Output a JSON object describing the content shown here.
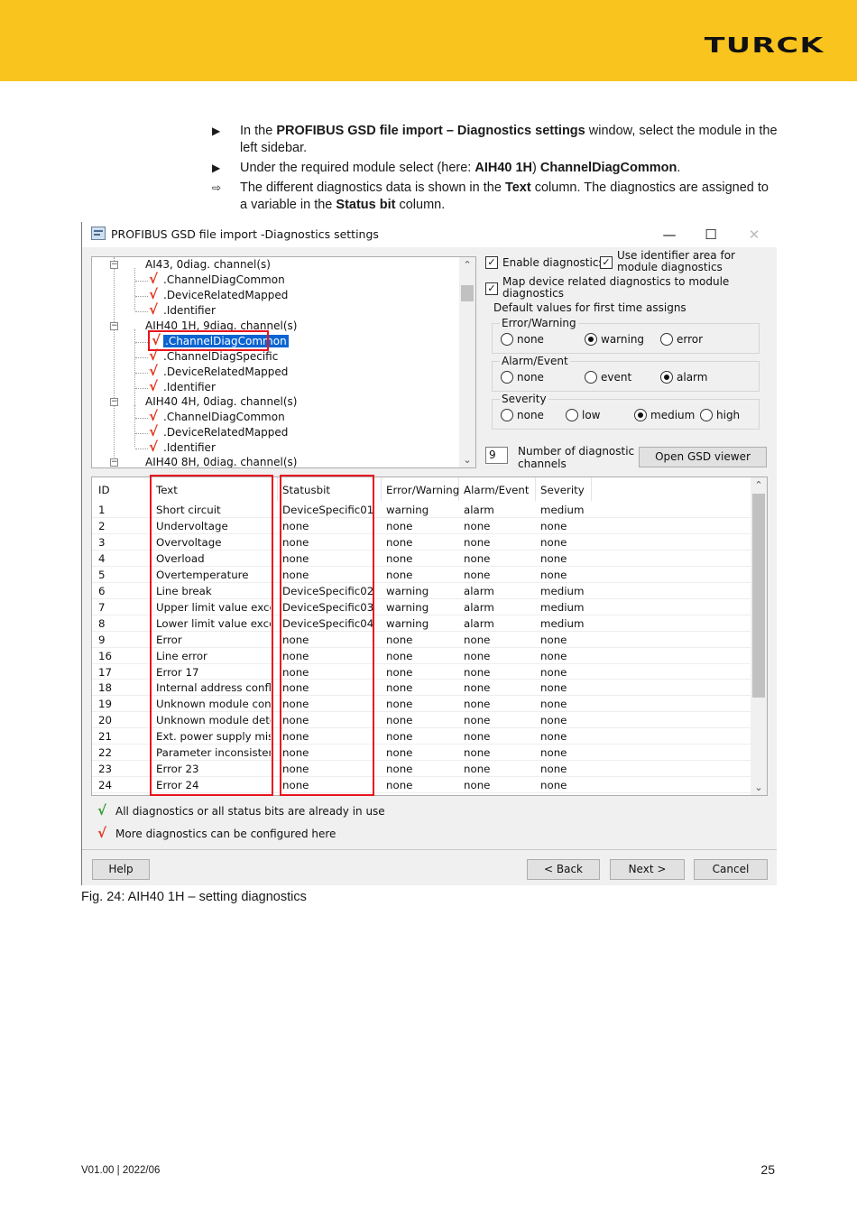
{
  "header": {
    "brand": "TURCK"
  },
  "instructions": [
    {
      "marker": "▶",
      "parts": [
        "In the ",
        "PROFIBUS GSD file import – Diagnostics settings",
        " window, select the module in the left sidebar."
      ]
    },
    {
      "marker": "▶",
      "parts": [
        "Under the required module select (here: ",
        "AIH40 1H",
        ") ",
        "ChannelDiagCommon",
        "."
      ]
    },
    {
      "marker": "⇨",
      "parts": [
        "The different diagnostics data is shown in the ",
        "Text",
        " column. The diagnostics are assigned to a variable in the ",
        "Status bit",
        " column."
      ]
    }
  ],
  "dialog": {
    "title": "PROFIBUS GSD file import -Diagnostics settings",
    "window_buttons": {
      "minimize": "—",
      "maximize": "☐",
      "close": "✕"
    },
    "tree": {
      "items": [
        {
          "kind": "module",
          "label": "AI43, 0diag. channel(s)"
        },
        {
          "kind": "leaf",
          "label": ".ChannelDiagCommon"
        },
        {
          "kind": "leaf",
          "label": ".DeviceRelatedMapped"
        },
        {
          "kind": "leaf",
          "label": ".Identifier"
        },
        {
          "kind": "module",
          "label": "AIH40 1H, 9diag. channel(s)"
        },
        {
          "kind": "leaf",
          "label": ".ChannelDiagCommon",
          "selected": true
        },
        {
          "kind": "leaf",
          "label": ".ChannelDiagSpecific"
        },
        {
          "kind": "leaf",
          "label": ".DeviceRelatedMapped"
        },
        {
          "kind": "leaf",
          "label": ".Identifier"
        },
        {
          "kind": "module",
          "label": "AIH40 4H, 0diag. channel(s)"
        },
        {
          "kind": "leaf",
          "label": ".ChannelDiagCommon"
        },
        {
          "kind": "leaf",
          "label": ".DeviceRelatedMapped"
        },
        {
          "kind": "leaf",
          "label": ".Identifier"
        },
        {
          "kind": "module",
          "label": "AIH40 8H, 0diag. channel(s)"
        }
      ]
    },
    "options": {
      "enable_diagnostics": {
        "label": "Enable diagnostics",
        "checked": true
      },
      "use_identifier": {
        "label_line1": "Use identifier area for",
        "label_line2": "module diagnostics",
        "checked": true
      },
      "map_device": {
        "label_line1": "Map device related diagnostics to module",
        "label_line2": "diagnostics",
        "checked": true
      },
      "defaults_title": "Default values for first time assigns",
      "error_warning": {
        "title": "Error/Warning",
        "options": [
          "none",
          "warning",
          "error"
        ],
        "selected": "warning"
      },
      "alarm_event": {
        "title": "Alarm/Event",
        "options": [
          "none",
          "event",
          "alarm"
        ],
        "selected": "alarm"
      },
      "severity": {
        "title": "Severity",
        "options": [
          "none",
          "low",
          "medium",
          "high"
        ],
        "selected": "medium"
      },
      "channels_value": "9",
      "channels_label_line1": "Number of diagnostic",
      "channels_label_line2": "channels",
      "open_gsd_viewer": "Open GSD viewer"
    },
    "table": {
      "headers": [
        "ID",
        "Text",
        "Statusbit",
        "Error/Warning",
        "Alarm/Event",
        "Severity"
      ],
      "rows": [
        [
          "1",
          "Short circuit",
          "DeviceSpecific01",
          "warning",
          "alarm",
          "medium"
        ],
        [
          "2",
          "Undervoltage",
          "none",
          "none",
          "none",
          "none"
        ],
        [
          "3",
          "Overvoltage",
          "none",
          "none",
          "none",
          "none"
        ],
        [
          "4",
          "Overload",
          "none",
          "none",
          "none",
          "none"
        ],
        [
          "5",
          "Overtemperature",
          "none",
          "none",
          "none",
          "none"
        ],
        [
          "6",
          "Line break",
          "DeviceSpecific02",
          "warning",
          "alarm",
          "medium"
        ],
        [
          "7",
          "Upper limit value excee...",
          "DeviceSpecific03",
          "warning",
          "alarm",
          "medium"
        ],
        [
          "8",
          "Lower limit value excee...",
          "DeviceSpecific04",
          "warning",
          "alarm",
          "medium"
        ],
        [
          "9",
          "Error",
          "none",
          "none",
          "none",
          "none"
        ],
        [
          "16",
          "Line error",
          "none",
          "none",
          "none",
          "none"
        ],
        [
          "17",
          "Error 17",
          "none",
          "none",
          "none",
          "none"
        ],
        [
          "18",
          "Internal address conflict",
          "none",
          "none",
          "none",
          "none"
        ],
        [
          "19",
          "Unknown module confi...",
          "none",
          "none",
          "none",
          "none"
        ],
        [
          "20",
          "Unknown module dete...",
          "none",
          "none",
          "none",
          "none"
        ],
        [
          "21",
          "Ext. power supply missing",
          "none",
          "none",
          "none",
          "none"
        ],
        [
          "22",
          "Parameter inconsistent",
          "none",
          "none",
          "none",
          "none"
        ],
        [
          "23",
          "Error 23",
          "none",
          "none",
          "none",
          "none"
        ],
        [
          "24",
          "Error 24",
          "none",
          "none",
          "none",
          "none"
        ]
      ]
    },
    "legend": {
      "green": "All diagnostics or all status bits are already in use",
      "red": "More diagnostics can be configured here",
      "green_color": "#2e9e2e",
      "red_color": "#e0341a"
    },
    "buttons": {
      "help": "Help",
      "back": "< Back",
      "next": "Next >",
      "cancel": "Cancel"
    }
  },
  "caption": "Fig. 24: AIH40 1H – setting diagnostics",
  "footer": {
    "version": "V01.00 | 2022/06",
    "page": "25"
  }
}
